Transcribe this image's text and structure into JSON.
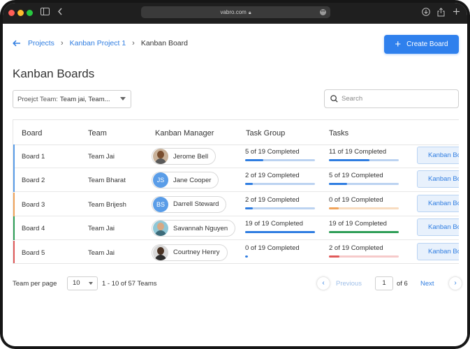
{
  "browser": {
    "url": "vabro.com"
  },
  "breadcrumb": {
    "items": [
      "Projects",
      "Kanban Project 1",
      "Kanban Board"
    ]
  },
  "actions": {
    "create_label": "Create Board"
  },
  "page": {
    "title": "Kanban Boards"
  },
  "filter": {
    "label": "Proejct Team:",
    "value": "Team jai, Team..."
  },
  "search": {
    "placeholder": "Search"
  },
  "table": {
    "columns": [
      "Board",
      "Team",
      "Kanban Manager",
      "Task Group",
      "Tasks"
    ],
    "action_label": "Kanban Board",
    "rows": [
      {
        "board": "Board 1",
        "team": "Team Jai",
        "manager": "Jerome Bell",
        "avatar": "photo",
        "initials": "",
        "accent": "#5a9de8",
        "task_group": "5 of 19 Completed",
        "tg_progress": 0.26,
        "tg_fill": "#2f7de1",
        "tg_track": "#bcd3f1",
        "tasks": "11 of 19 Completed",
        "t_progress": 0.58,
        "t_fill": "#2f7de1",
        "t_track": "#bcd3f1"
      },
      {
        "board": "Board 2",
        "team": "Team Bharat",
        "manager": "Jane Cooper",
        "avatar": "initials",
        "initials": "JS",
        "accent": "#5a9de8",
        "task_group": "2 of 19 Completed",
        "tg_progress": 0.11,
        "tg_fill": "#2f7de1",
        "tg_track": "#bcd3f1",
        "tasks": "5 of 19 Completed",
        "t_progress": 0.26,
        "t_fill": "#2f7de1",
        "t_track": "#bcd3f1"
      },
      {
        "board": "Board 3",
        "team": "Team Brijesh",
        "manager": "Darrell Steward",
        "avatar": "initials",
        "initials": "BS",
        "accent": "#f0a35a",
        "task_group": "2 of 19 Completed",
        "tg_progress": 0.11,
        "tg_fill": "#2f7de1",
        "tg_track": "#bcd3f1",
        "tasks": "0 of 19 Completed",
        "t_progress": 0.14,
        "t_fill": "#f0a35a",
        "t_track": "#f8dcc0"
      },
      {
        "board": "Board 4",
        "team": "Team Jai",
        "manager": "Savannah Nguyen",
        "avatar": "photo",
        "initials": "",
        "accent": "#2e9e57",
        "task_group": "19 of 19 Completed",
        "tg_progress": 1.0,
        "tg_fill": "#2f7de1",
        "tg_track": "#bcd3f1",
        "tasks": "19 of 19 Completed",
        "t_progress": 1.0,
        "t_fill": "#2e9e57",
        "t_track": "#bfe3cd"
      },
      {
        "board": "Board 5",
        "team": "Team Jai",
        "manager": "Courtney Henry",
        "avatar": "photo",
        "initials": "",
        "accent": "#e05a5a",
        "task_group": "0 of 19 Completed",
        "tg_progress": 0.04,
        "tg_fill": "#2f7de1",
        "tg_track": "#ffffff",
        "tasks": "2 of 19 Completed",
        "t_progress": 0.15,
        "t_fill": "#e05a5a",
        "t_track": "#f6caca"
      }
    ]
  },
  "pagination": {
    "per_page_label": "Team per page",
    "per_page_value": "10",
    "range": "1 - 10 of 57 Teams",
    "previous_label": "Previous",
    "current_page": "1",
    "of_label": "of 6",
    "next_label": "Next"
  },
  "colors": {
    "accent": "#2f80ed"
  }
}
